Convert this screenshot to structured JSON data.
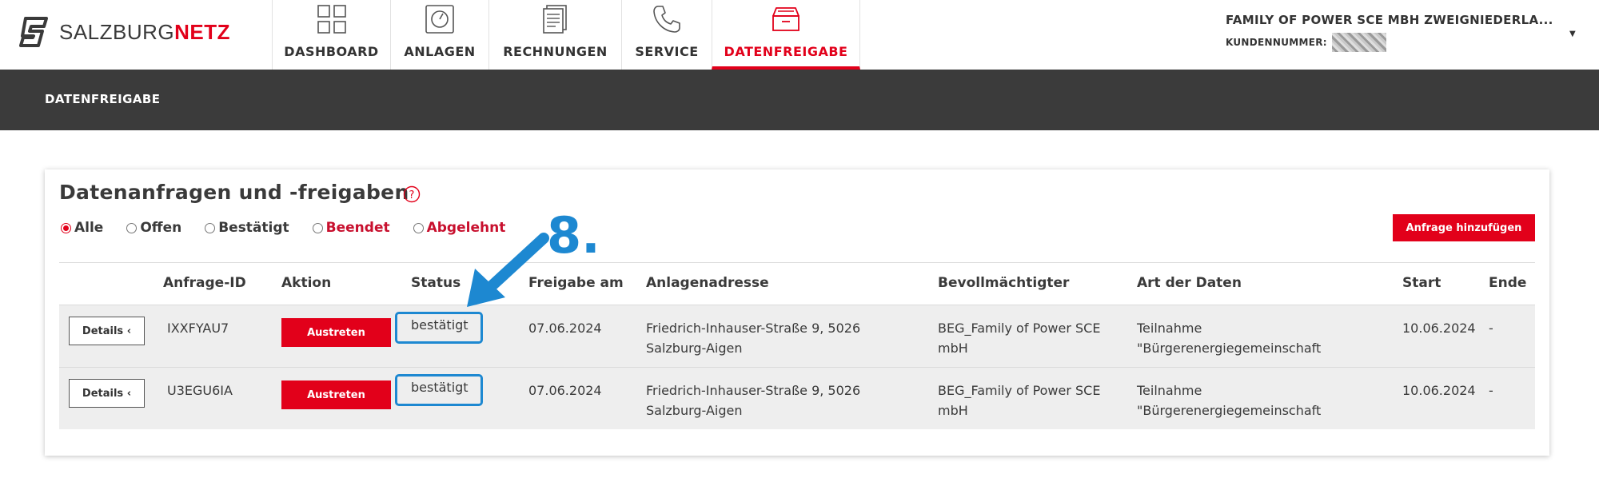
{
  "brand": {
    "name_plain": "SALZBURG",
    "name_bold": "NETZ",
    "accent_color": "#e2001a"
  },
  "nav": [
    {
      "label": "DASHBOARD",
      "icon": "dashboard-grid-icon",
      "active": false
    },
    {
      "label": "ANLAGEN",
      "icon": "meter-gauge-icon",
      "active": false
    },
    {
      "label": "RECHNUNGEN",
      "icon": "documents-icon",
      "active": false
    },
    {
      "label": "SERVICE",
      "icon": "phone-icon",
      "active": false
    },
    {
      "label": "DATENFREIGABE",
      "icon": "drawer-inbox-icon",
      "active": true
    }
  ],
  "account": {
    "name": "FAMILY OF POWER SCE MBH ZWEIGNIEDERLA...",
    "number_label": "KUNDENNUMMER:"
  },
  "subheader": {
    "title": "DATENFREIGABE"
  },
  "card": {
    "title": "Datenanfragen und -freigaben",
    "filters": [
      {
        "label": "Alle",
        "checked": true,
        "red": false
      },
      {
        "label": "Offen",
        "checked": false,
        "red": false
      },
      {
        "label": "Bestätigt",
        "checked": false,
        "red": false
      },
      {
        "label": "Beendet",
        "checked": false,
        "red": true
      },
      {
        "label": "Abgelehnt",
        "checked": false,
        "red": true
      }
    ],
    "add_button": "Anfrage hinzufügen",
    "columns": [
      "Anfrage-ID",
      "Aktion",
      "Status",
      "Freigabe am",
      "Anlagenadresse",
      "Bevollmächtigter",
      "Art der Daten",
      "Start",
      "Ende"
    ],
    "rows": [
      {
        "details": "Details ‹",
        "id": "IXXFYAU7",
        "action": "Austreten",
        "status": "bestätigt",
        "freigabe_am": "07.06.2024",
        "adresse": "Friedrich-Inhauser-Straße 9, 5026 Salzburg-Aigen",
        "bevollmaechtigter": "BEG_Family of Power SCE mbH",
        "art": "Teilnahme \"Bürgerenergiegemeinschaft",
        "start": "10.06.2024",
        "ende": "-"
      },
      {
        "details": "Details ‹",
        "id": "U3EGU6IA",
        "action": "Austreten",
        "status": "bestätigt",
        "freigabe_am": "07.06.2024",
        "adresse": "Friedrich-Inhauser-Straße 9, 5026 Salzburg-Aigen",
        "bevollmaechtigter": "BEG_Family of Power SCE mbH",
        "art": "Teilnahme \"Bürgerenergiegemeinschaft",
        "start": "10.06.2024",
        "ende": "-"
      }
    ]
  },
  "annotation": {
    "step": "8.",
    "color": "#1d88d1"
  }
}
